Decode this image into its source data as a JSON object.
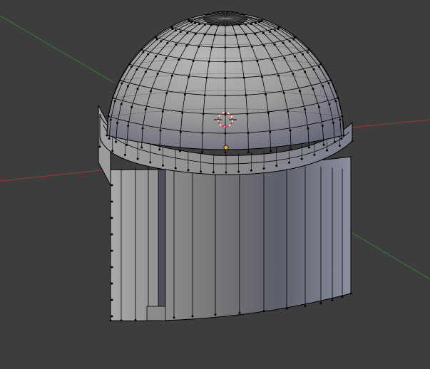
{
  "viewport": {
    "background_color": "#3d3d3d",
    "axis_x_color": "#9a3a3a",
    "axis_y_color": "#3a7a3a",
    "grid_visible": true
  },
  "object": {
    "icon": "dome-cylinder-mesh-icon",
    "mode": "edit",
    "wire_color": "#000000",
    "vertex_color": "#000000",
    "face_light_color": "#b4b4b4",
    "face_dark_color": "#5a5a66"
  },
  "cursor_3d": {
    "icon": "3d-cursor-icon",
    "ring_color_a": "#ffffff",
    "ring_color_b": "#d03030"
  },
  "origin": {
    "icon": "object-origin-icon",
    "color": "#e8a040"
  }
}
